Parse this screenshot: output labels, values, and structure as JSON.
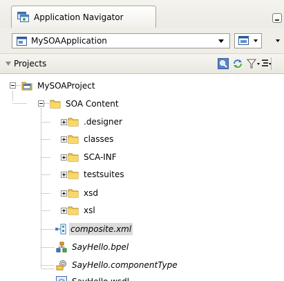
{
  "tab": {
    "title": "Application Navigator",
    "icon": "application-navigator-icon"
  },
  "application": {
    "selected": "MySOAApplication"
  },
  "projects": {
    "label": "Projects"
  },
  "tree": {
    "project": "MySOAProject",
    "soa_content": "SOA Content",
    "folders": [
      ".designer",
      "classes",
      "SCA-INF",
      "testsuites",
      "xsd",
      "xsl"
    ],
    "files": [
      {
        "label": "composite.xml",
        "icon": "composite-icon"
      },
      {
        "label": "SayHello.bpel",
        "icon": "bpel-process-icon"
      },
      {
        "label": "SayHello.componentType",
        "icon": "component-type-icon"
      },
      {
        "label": "SayHello.wsdl",
        "icon": "wsdl-icon"
      }
    ]
  },
  "colors": {
    "selection": "#dcdcdc",
    "folder": "#f1c84a",
    "tree_lines": "#a0a0a0"
  }
}
